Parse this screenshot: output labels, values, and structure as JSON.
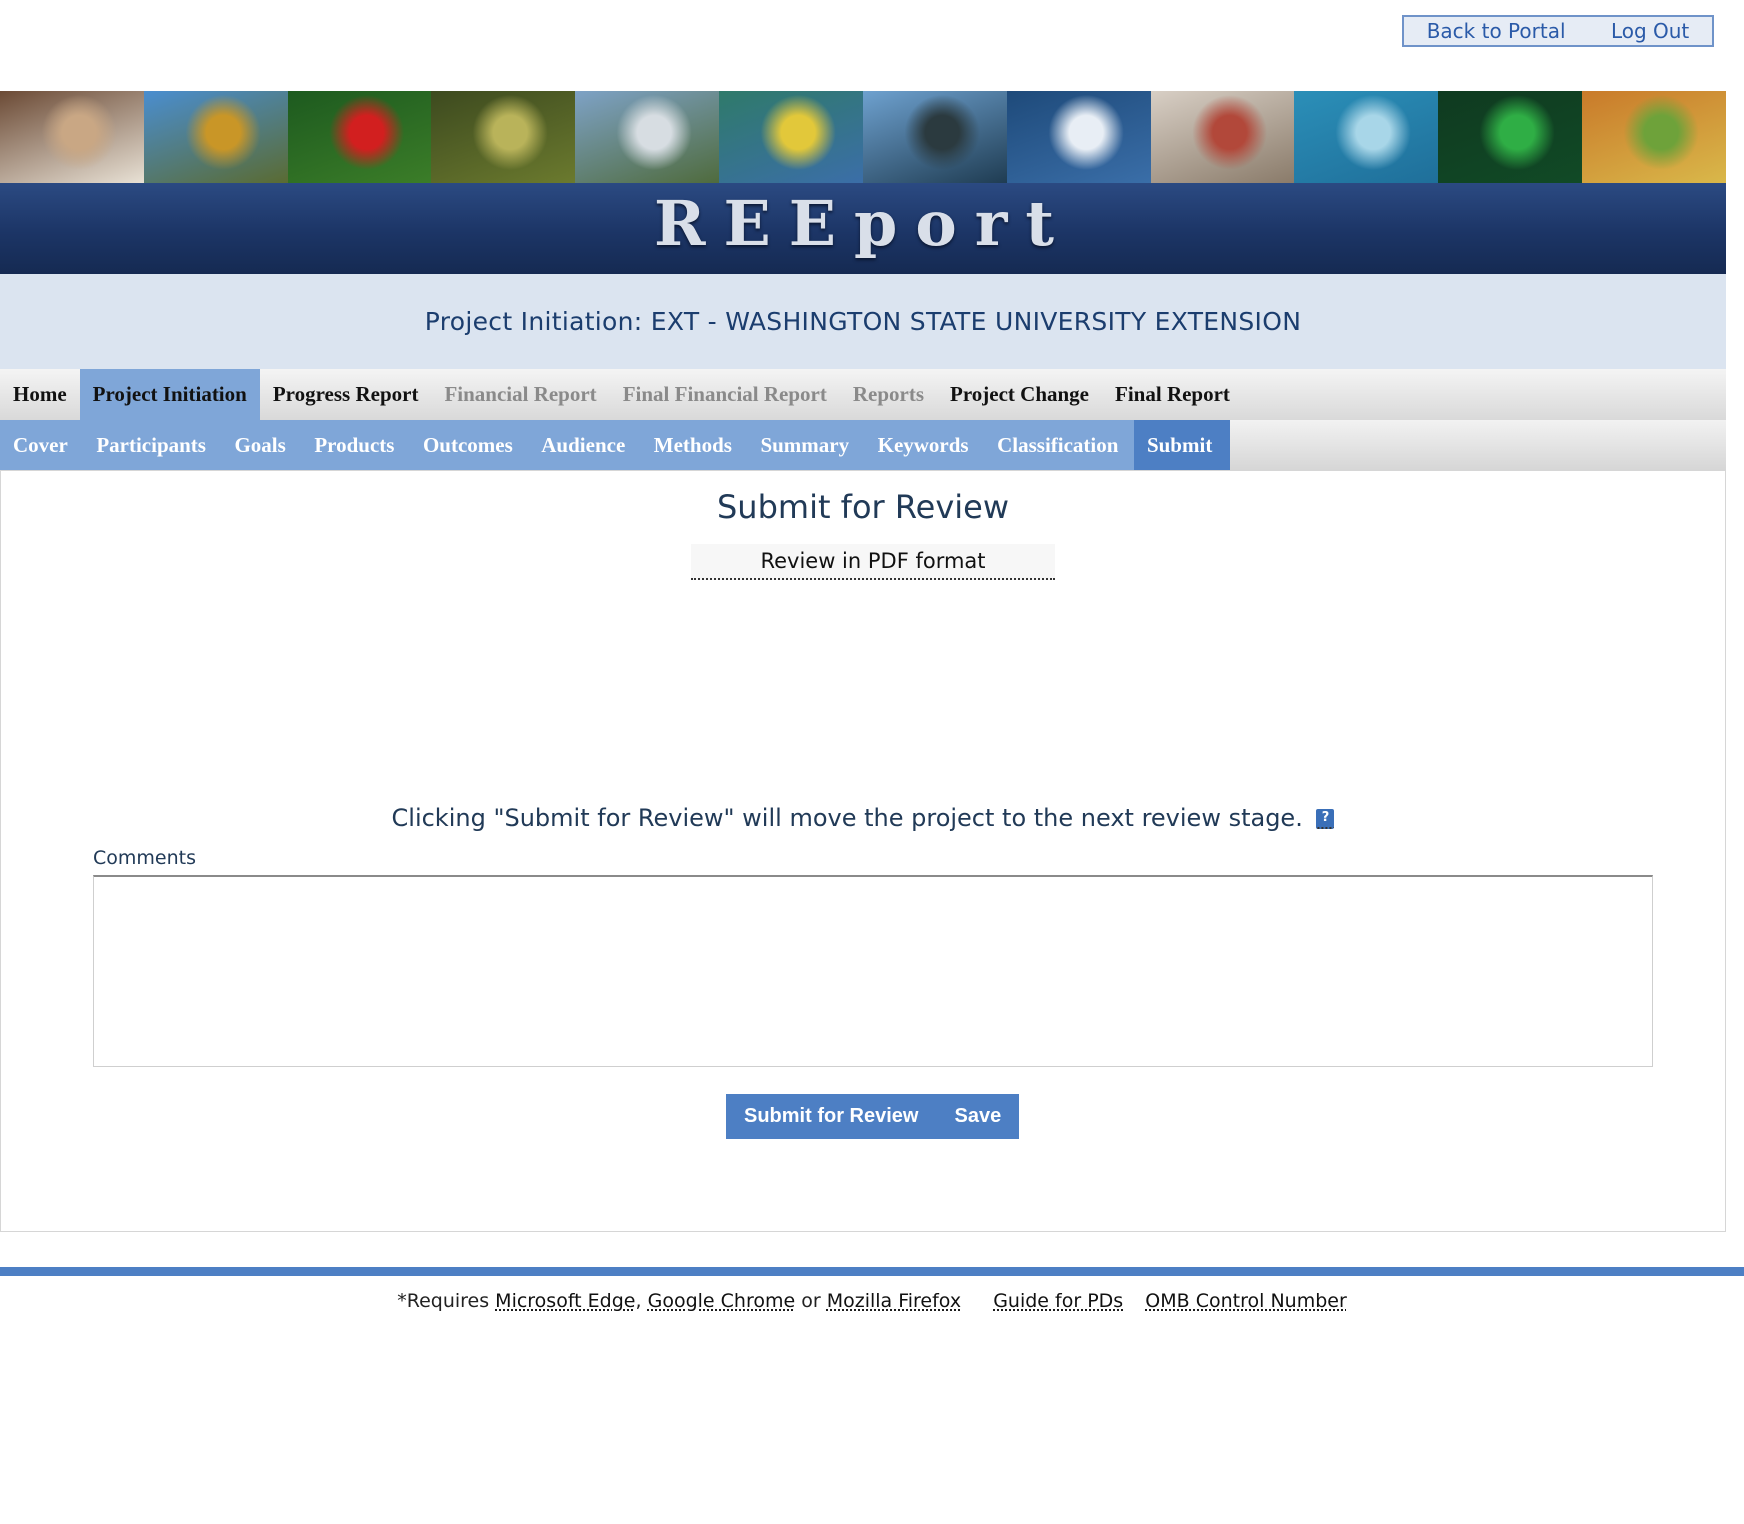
{
  "portal": {
    "back_label": "Back to Portal",
    "logout_label": "Log Out"
  },
  "banner": {
    "logo": "REEport",
    "photos": [
      {
        "name": "scientist-photo",
        "colors": [
          "#6b4a35",
          "#c9a784",
          "#e8e1d5"
        ]
      },
      {
        "name": "excavator-photo",
        "colors": [
          "#4a8ed0",
          "#c99627",
          "#5a6b32"
        ]
      },
      {
        "name": "red-flower-photo",
        "colors": [
          "#1d5a1f",
          "#d21f1f",
          "#3b7d28"
        ]
      },
      {
        "name": "forest-photo",
        "colors": [
          "#3d4a1f",
          "#b9b35a",
          "#6b7a2e"
        ]
      },
      {
        "name": "mountains-photo",
        "colors": [
          "#7ea2c6",
          "#d7dde2",
          "#4f6b3d"
        ]
      },
      {
        "name": "bird-photo",
        "colors": [
          "#2f7a6a",
          "#e2c83a",
          "#3b6ea8"
        ]
      },
      {
        "name": "cows-photo",
        "colors": [
          "#6ea1cf",
          "#2b3a3f",
          "#1f3c52"
        ]
      },
      {
        "name": "waterfall-photo",
        "colors": [
          "#1e4a7a",
          "#e8eef5",
          "#3a6ea8"
        ]
      },
      {
        "name": "microscope-photo",
        "colors": [
          "#d8cfc5",
          "#b2483a",
          "#8a7b6a"
        ]
      },
      {
        "name": "dolphin-photo",
        "colors": [
          "#2b8fb8",
          "#a8d6e8",
          "#1f6f9a"
        ]
      },
      {
        "name": "frog-photo",
        "colors": [
          "#0f3a20",
          "#2fae45",
          "#114a26"
        ]
      },
      {
        "name": "farm-photo",
        "colors": [
          "#c97a2a",
          "#6ea23a",
          "#d9b84a"
        ]
      }
    ]
  },
  "project_title": "Project Initiation: EXT - WASHINGTON STATE UNIVERSITY EXTENSION",
  "main_nav": [
    {
      "label": "Home",
      "state": "normal"
    },
    {
      "label": "Project Initiation",
      "state": "active"
    },
    {
      "label": "Progress Report",
      "state": "normal"
    },
    {
      "label": "Financial Report",
      "state": "disabled"
    },
    {
      "label": "Final Financial Report",
      "state": "disabled"
    },
    {
      "label": "Reports",
      "state": "disabled"
    },
    {
      "label": "Project Change",
      "state": "normal"
    },
    {
      "label": "Final Report",
      "state": "normal"
    }
  ],
  "sub_nav": [
    {
      "label": "Cover",
      "active": false
    },
    {
      "label": "Participants",
      "active": false
    },
    {
      "label": "Goals",
      "active": false
    },
    {
      "label": "Products",
      "active": false
    },
    {
      "label": "Outcomes",
      "active": false
    },
    {
      "label": "Audience",
      "active": false
    },
    {
      "label": "Methods",
      "active": false
    },
    {
      "label": "Summary",
      "active": false
    },
    {
      "label": "Keywords",
      "active": false
    },
    {
      "label": "Classification",
      "active": false
    },
    {
      "label": "Submit",
      "active": true
    }
  ],
  "content": {
    "heading": "Submit for Review",
    "pdf_link": "Review in PDF format",
    "notice": "Clicking \"Submit for Review\" will move the project to the next review stage.",
    "help_icon": "?",
    "comments_label": "Comments",
    "comments_value": "",
    "submit_label": "Submit for Review",
    "save_label": "Save"
  },
  "footer": {
    "requires_prefix": "*Requires",
    "edge": "Microsoft Edge",
    "comma": ",",
    "chrome": "Google Chrome",
    "or": "or",
    "firefox": "Mozilla Firefox",
    "guide": "Guide for PDs",
    "omb": "OMB Control Number"
  },
  "colors": {
    "accent": "#4d7fc4",
    "nav_active": "#7fa6d8",
    "title_band": "#dbe4f0",
    "logo_band": "#1c3566"
  }
}
